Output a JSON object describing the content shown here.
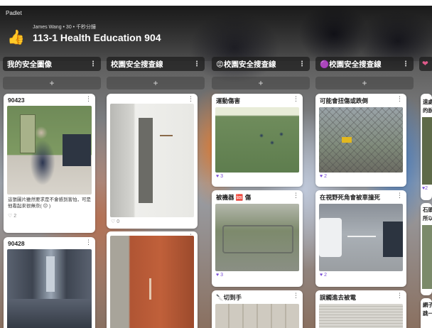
{
  "app": {
    "brand": "Padlet"
  },
  "header": {
    "icon": "thumbs-up-icon",
    "author": "James Wang • 30 • 千秒分鐘",
    "title": "113-1 Health Education 904"
  },
  "columns": [
    {
      "label": "我的安全圖像",
      "add": "+",
      "cards": [
        {
          "title": "90423",
          "caption": "這張圖片雖然要求是不會感到害怕，可是他看起來很無奈( 😐 )",
          "likes": "2"
        },
        {
          "title": "90428",
          "caption": "",
          "likes": ""
        }
      ]
    },
    {
      "label": "校園安全搜查線",
      "add": "+",
      "cards": [
        {
          "title": "",
          "caption": "",
          "likes": "0"
        },
        {
          "title": "",
          "caption": "",
          "likes": ""
        }
      ]
    },
    {
      "label": "😡校園安全搜查線",
      "add": "+",
      "cards": [
        {
          "title": "運動傷害",
          "caption": "",
          "likes": "3"
        },
        {
          "title": "被機器 🆘 傷",
          "caption": "",
          "likes": "3"
        },
        {
          "title": "🔪切到手",
          "caption": "",
          "likes": ""
        }
      ]
    },
    {
      "label": "🟣校園安全搜查線",
      "add": "+",
      "cards": [
        {
          "title": "可能會扭傷或跌倒",
          "caption": "",
          "likes": "2"
        },
        {
          "title": "在視野死角會被車撞死",
          "caption": "",
          "likes": "2"
        },
        {
          "title": "誤觸進去被電",
          "caption": "",
          "likes": ""
        }
      ]
    }
  ],
  "partial_column": {
    "heart": "❤",
    "snips": [
      "遠處",
      "的說",
      "2",
      "石頭",
      "所以",
      "網子",
      "跳一"
    ]
  },
  "colors": {
    "like": "#7a4dd8",
    "header_bg": "#1e1e1e"
  }
}
